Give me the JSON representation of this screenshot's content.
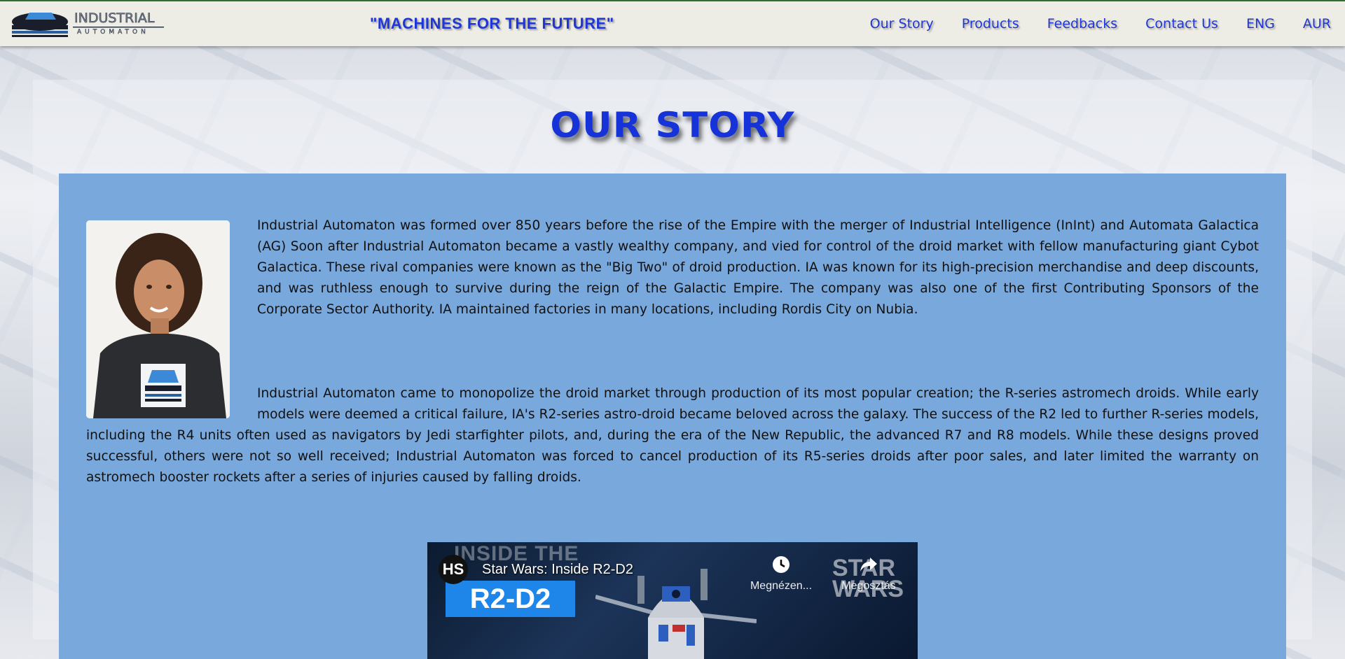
{
  "header": {
    "logo_line1": "INDUSTRIAL",
    "logo_line2": "AUTOMATON",
    "slogan": "\"MACHINES FOR THE FUTURE\"",
    "nav": [
      "Our Story",
      "Products",
      "Feedbacks",
      "Contact Us",
      "ENG",
      "AUR"
    ]
  },
  "page": {
    "title": "OUR STORY"
  },
  "story": {
    "paragraph1": "Industrial Automaton was formed over 850 years before the rise of the Empire with the merger of Industrial Intelligence (InInt) and Automata Galactica (AG) Soon after Industrial Automaton became a vastly wealthy company, and vied for control of the droid market with fellow manufacturing giant Cybot Galactica. These rival companies were known as the \"Big Two\" of droid production. IA was known for its high-precision merchandise and deep discounts, and was ruthless enough to survive during the reign of the Galactic Empire. The company was also one of the first Contributing Sponsors of the Corporate Sector Authority. IA maintained factories in many locations, including Rordis City on Nubia.",
    "paragraph2": "Industrial Automaton came to monopolize the droid market through production of its most popular creation; the R-series astromech droids. While early models were deemed a critical failure, IA's R2-series astro-droid became beloved across the galaxy. The success of the R2 led to further R-series models, including the R4 units often used as navigators by Jedi starfighter pilots, and, during the era of the New Republic, the advanced R7 and R8 models. While these designs proved successful, others were not so well received; Industrial Automaton was forced to cancel production of its R5-series droids after poor sales, and later limited the warranty on astromech booster rockets after a series of injuries caused by falling droids."
  },
  "video": {
    "channel_badge": "HS",
    "title": "Star Wars: Inside R2-D2",
    "thumbnail_heading": "INSIDE THE",
    "thumbnail_name": "R2-D2",
    "watch_later_label": "Megnézen...",
    "share_label": "Megosztás",
    "brand_logo_line1": "STAR",
    "brand_logo_line2": "WARS"
  }
}
